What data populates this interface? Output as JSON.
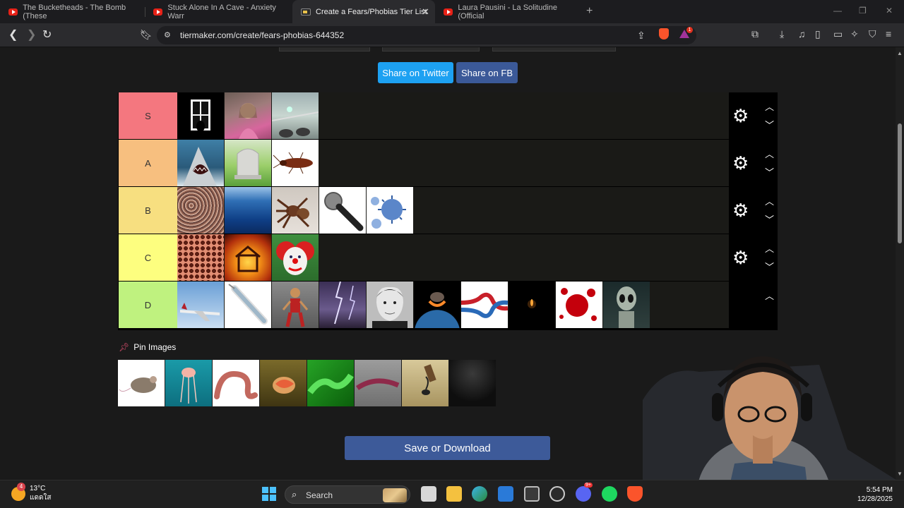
{
  "browser": {
    "tabs": [
      {
        "label": "The Bucketheads - The Bomb (These"
      },
      {
        "label": "Stuck Alone In A Cave - Anxiety Warr"
      },
      {
        "label": "Create a Fears/Phobias Tier List"
      },
      {
        "label": "Laura Pausini - La Solitudine (Official"
      }
    ],
    "new_tab": "+",
    "url": "tiermaker.com/create/fears-phobias-644352",
    "rewards_count": "1"
  },
  "share": {
    "twitter_label": "Share on Twitter",
    "fb_label": "Share on FB"
  },
  "tiers": [
    {
      "label": "S",
      "color": "#f4777f",
      "items": [
        "dark-window",
        "screaming-girl",
        "glass-floor-height"
      ]
    },
    {
      "label": "A",
      "color": "#f7bf7f",
      "items": [
        "shark-attack",
        "gravestone",
        "cockroach"
      ]
    },
    {
      "label": "B",
      "color": "#f7df80",
      "items": [
        "crowd",
        "deep-ocean",
        "tarantula",
        "microphone",
        "virus"
      ]
    },
    {
      "label": "C",
      "color": "#fdfe7f",
      "items": [
        "trypophobia-holes",
        "house-fire",
        "clown"
      ]
    },
    {
      "label": "D",
      "color": "#bff27f",
      "items": [
        "airplane",
        "syringe",
        "marionette-doll",
        "lightning-storm",
        "man-portrait",
        "asteroid-earth",
        "knot",
        "candle-darkness",
        "blood-splatter",
        "alien"
      ]
    }
  ],
  "pool": {
    "title": "Pin Images",
    "items": [
      "mouse",
      "jellyfish",
      "earthworm",
      "lizard",
      "green-snake",
      "centipede",
      "scorpion",
      "dark-figure"
    ]
  },
  "save_label": "Save or Download",
  "taskbar": {
    "temperature": "13°C",
    "weather_desc": "แดดใส",
    "weather_badge": "4",
    "search_label": "Search",
    "discord_badge": "9+",
    "time": "5:54 PM",
    "date": "12/28/2025"
  }
}
